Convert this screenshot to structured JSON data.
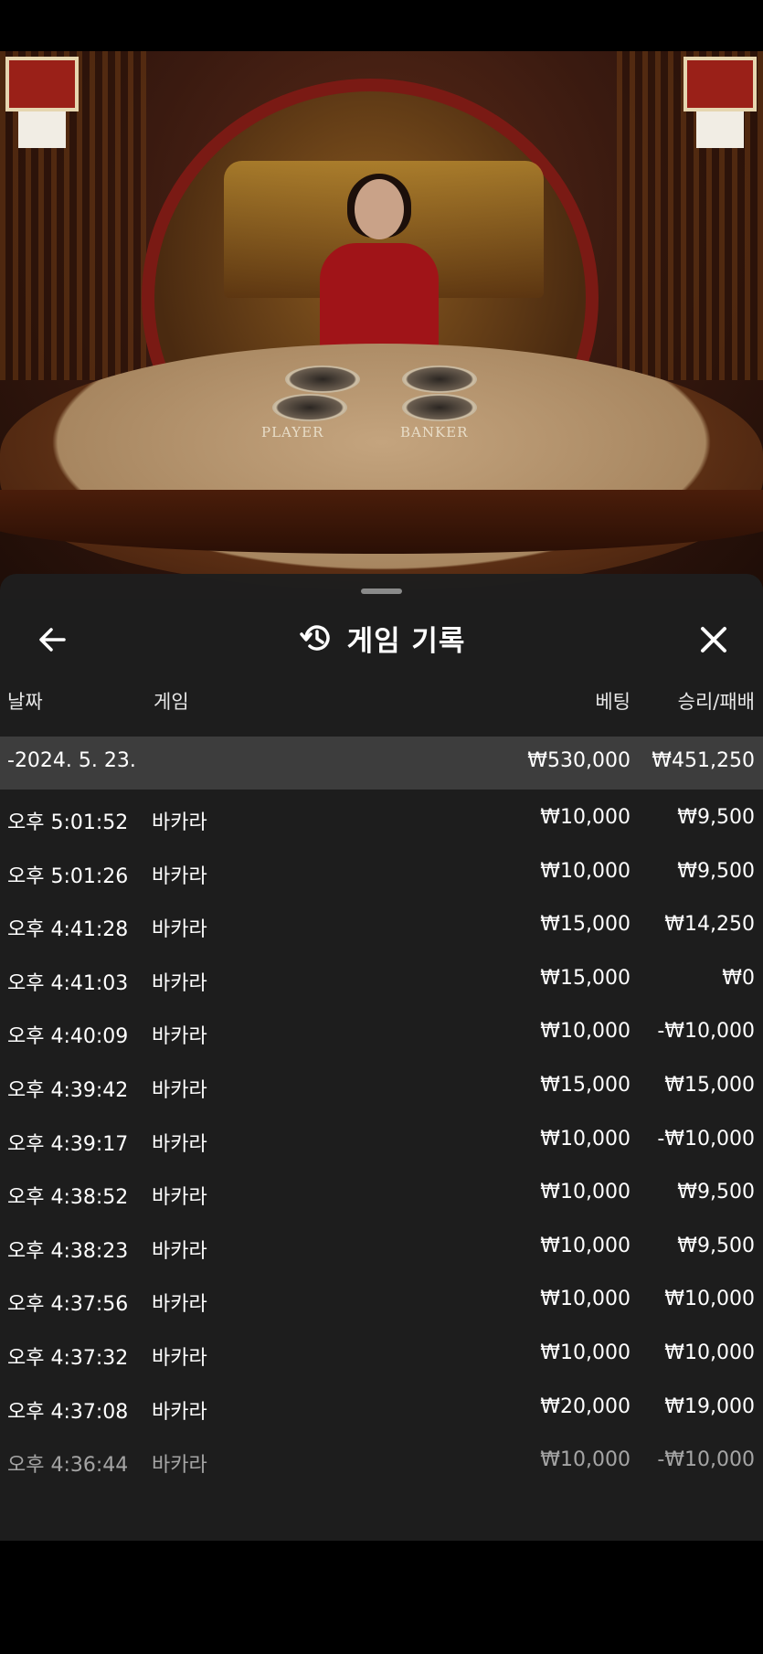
{
  "video": {
    "zones": {
      "player": "PLAYER",
      "banker": "BANKER"
    }
  },
  "history": {
    "title": "게임 기록",
    "icons": {
      "back": "arrow-left-icon",
      "history": "history-clock-icon",
      "close": "close-icon"
    },
    "columns": {
      "date": "날짜",
      "game": "게임",
      "bet": "베팅",
      "winloss": "승리/패배"
    },
    "summary": {
      "date": "-2024. 5. 23.",
      "bet": "₩530,000",
      "winloss": "₩451,250"
    },
    "rows": [
      {
        "time": "오후 5:01:52",
        "game": "바카라",
        "bet": "₩10,000",
        "winloss": "₩9,500"
      },
      {
        "time": "오후 5:01:26",
        "game": "바카라",
        "bet": "₩10,000",
        "winloss": "₩9,500"
      },
      {
        "time": "오후 4:41:28",
        "game": "바카라",
        "bet": "₩15,000",
        "winloss": "₩14,250"
      },
      {
        "time": "오후 4:41:03",
        "game": "바카라",
        "bet": "₩15,000",
        "winloss": "₩0"
      },
      {
        "time": "오후 4:40:09",
        "game": "바카라",
        "bet": "₩10,000",
        "winloss": "-₩10,000"
      },
      {
        "time": "오후 4:39:42",
        "game": "바카라",
        "bet": "₩15,000",
        "winloss": "₩15,000"
      },
      {
        "time": "오후 4:39:17",
        "game": "바카라",
        "bet": "₩10,000",
        "winloss": "-₩10,000"
      },
      {
        "time": "오후 4:38:52",
        "game": "바카라",
        "bet": "₩10,000",
        "winloss": "₩9,500"
      },
      {
        "time": "오후 4:38:23",
        "game": "바카라",
        "bet": "₩10,000",
        "winloss": "₩9,500"
      },
      {
        "time": "오후 4:37:56",
        "game": "바카라",
        "bet": "₩10,000",
        "winloss": "₩10,000"
      },
      {
        "time": "오후 4:37:32",
        "game": "바카라",
        "bet": "₩10,000",
        "winloss": "₩10,000"
      },
      {
        "time": "오후 4:37:08",
        "game": "바카라",
        "bet": "₩20,000",
        "winloss": "₩19,000"
      },
      {
        "time": "오후 4:36:44",
        "game": "바카라",
        "bet": "₩10,000",
        "winloss": "-₩10,000"
      }
    ]
  }
}
